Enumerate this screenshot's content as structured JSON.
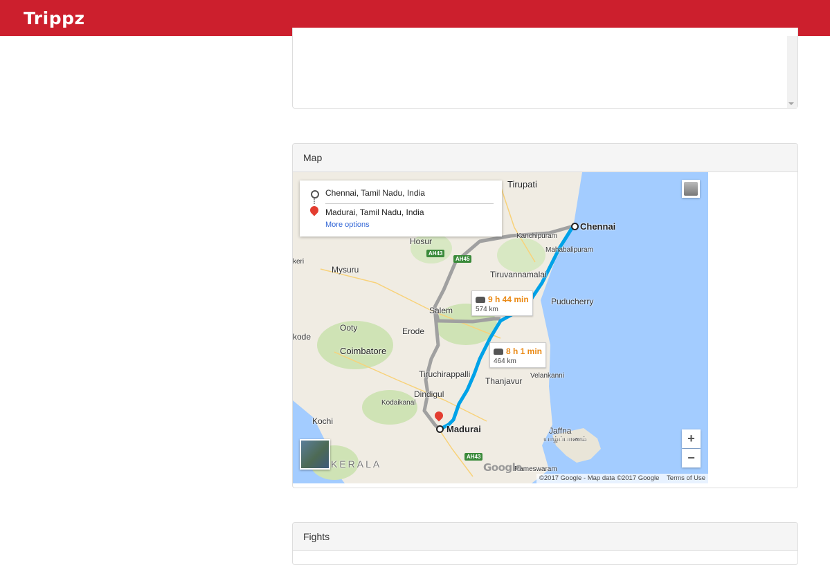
{
  "app": {
    "brand": "Trippz"
  },
  "map_panel": {
    "title": "Map",
    "directions": {
      "origin": "Chennai, Tamil Nadu, India",
      "destination": "Madurai, Tamil Nadu, India",
      "more_options": "More options"
    },
    "routes": [
      {
        "time": "9 h 44 min",
        "distance": "574 km"
      },
      {
        "time": "8 h 1 min",
        "distance": "464 km"
      }
    ],
    "places": {
      "tirupati": "Tirupati",
      "chennai": "Chennai",
      "kanchipuram": "Kanchipuram",
      "mahabalipuram": "Mahabalipuram",
      "hosur": "Hosur",
      "mysuru": "Mysuru",
      "tiruvannamalai": "Tiruvannamalai",
      "puducherry": "Puducherry",
      "salem": "Salem",
      "ooty": "Ooty",
      "erode": "Erode",
      "kozhikode": "kode",
      "keri": "keri",
      "coimbatore": "Coimbatore",
      "tiruchirappalli": "Tiruchirappalli",
      "thanjavur": "Thanjavur",
      "velankanni": "Velankanni",
      "dindigul": "Dindigul",
      "kodaikanal": "Kodaikanal",
      "kochi": "Kochi",
      "madurai": "Madurai",
      "jaffna": "Jaffna",
      "jaffna_tamil": "யாழ்ப்பாணம்",
      "kerala": "KERALA",
      "rameswaram": "Rameswaram"
    },
    "highways": {
      "ah43_north": "AH43",
      "ah45": "AH45",
      "ah43_south": "AH43"
    },
    "zoom_in": "+",
    "zoom_out": "−",
    "attribution": "©2017 Google - Map data ©2017 Google",
    "terms": "Terms of Use",
    "google_logo": "Google"
  },
  "fights_panel": {
    "title": "Fights"
  },
  "colors": {
    "topbar": "#cc1f2d",
    "sea": "#a3ccff",
    "land": "#f0ece3",
    "route_primary": "#00a2e8",
    "route_alt": "#a0a0a0"
  }
}
